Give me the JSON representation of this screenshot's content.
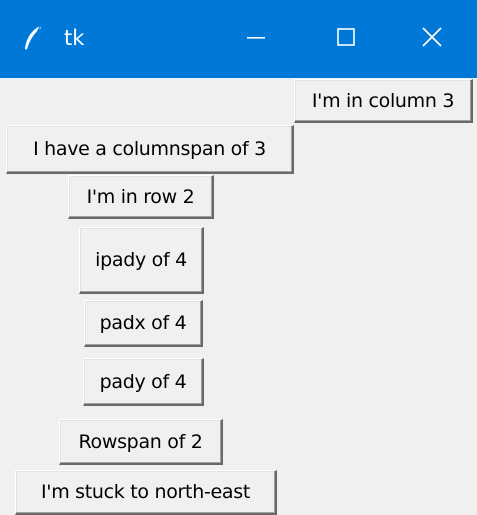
{
  "window": {
    "title": "tk",
    "titlebar_color": "#0078d7",
    "background_color": "#f0f0f0",
    "icons": {
      "app": "feather-icon",
      "minimize": "minimize-icon",
      "maximize": "maximize-icon",
      "close": "close-icon"
    }
  },
  "buttons": {
    "column3": "I'm in column 3",
    "columnspan3": "I have a columnspan of 3",
    "row2": "I'm in row 2",
    "ipady4": "ipady of 4",
    "padx4": "padx of 4",
    "pady4": "pady of 4",
    "rowspan2": "Rowspan of 2",
    "north_east": "I'm stuck to north-east"
  }
}
